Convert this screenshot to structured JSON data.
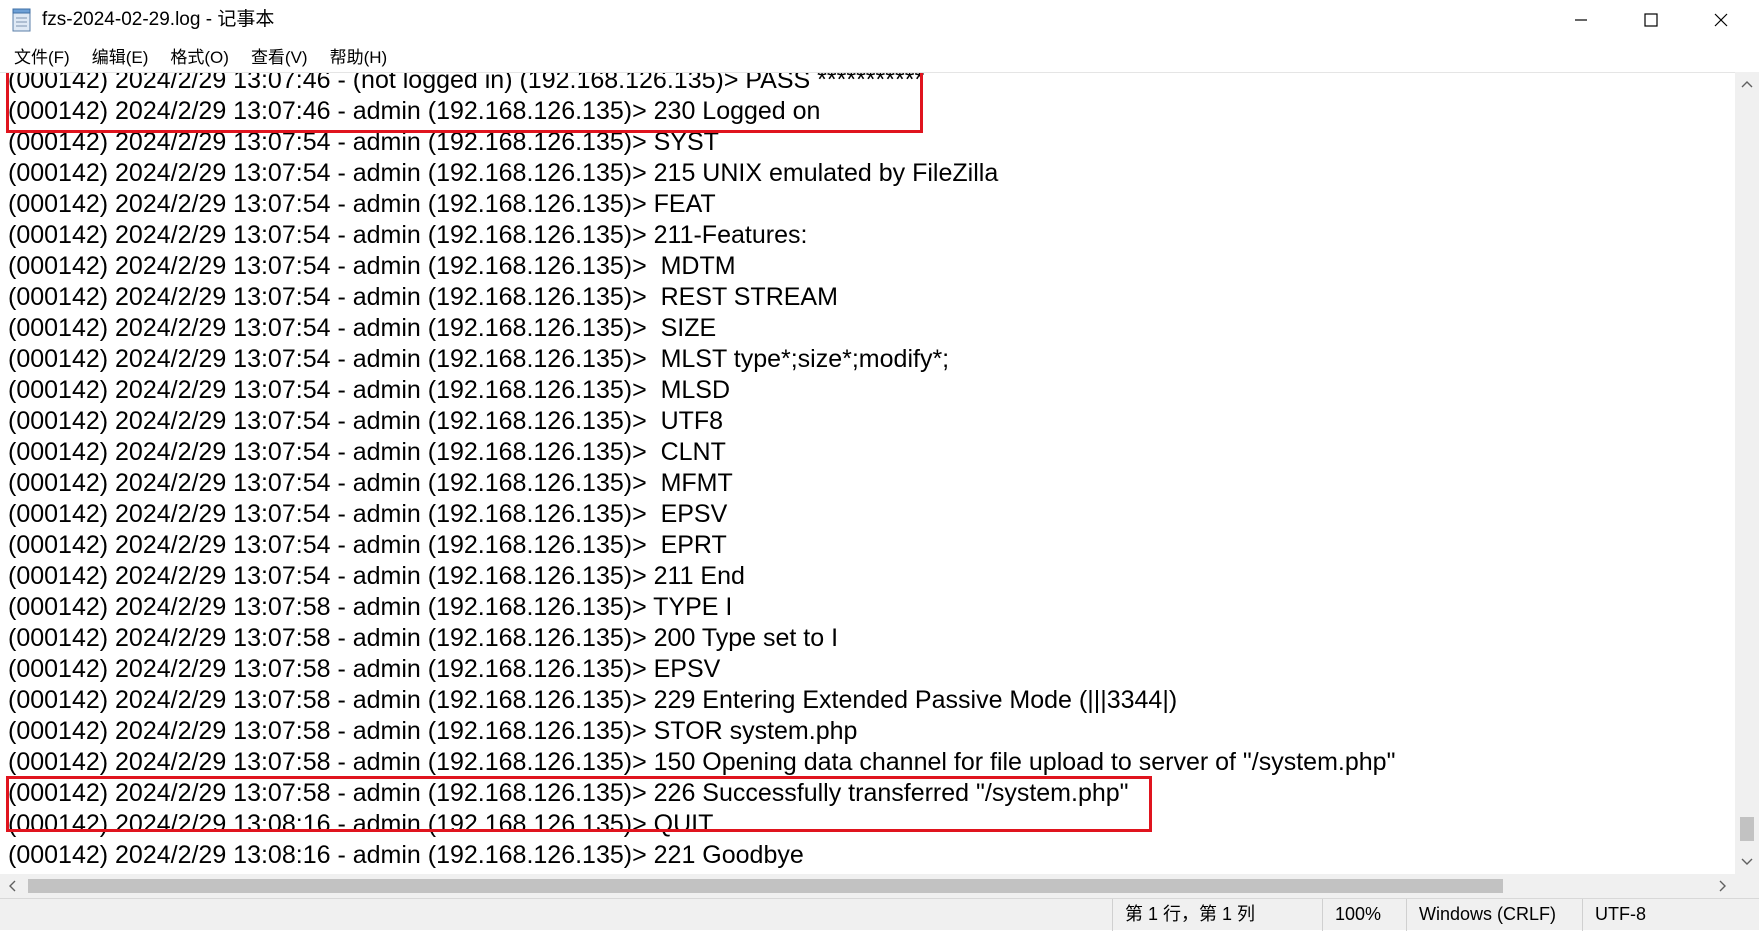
{
  "window": {
    "title": "fzs-2024-02-29.log - 记事本",
    "controls": {
      "minimize": "—",
      "maximize": "☐",
      "close": "✕"
    }
  },
  "menu": {
    "items": [
      {
        "label": "文件(F)"
      },
      {
        "label": "编辑(E)"
      },
      {
        "label": "格式(O)"
      },
      {
        "label": "查看(V)"
      },
      {
        "label": "帮助(H)"
      }
    ]
  },
  "editor": {
    "lines": [
      "(000142) 2024/2/29 13:07:46 - (not logged in) (192.168.126.135)> PASS ***********",
      "(000142) 2024/2/29 13:07:46 - admin (192.168.126.135)> 230 Logged on",
      "(000142) 2024/2/29 13:07:54 - admin (192.168.126.135)> SYST",
      "(000142) 2024/2/29 13:07:54 - admin (192.168.126.135)> 215 UNIX emulated by FileZilla",
      "(000142) 2024/2/29 13:07:54 - admin (192.168.126.135)> FEAT",
      "(000142) 2024/2/29 13:07:54 - admin (192.168.126.135)> 211-Features:",
      "(000142) 2024/2/29 13:07:54 - admin (192.168.126.135)>  MDTM",
      "(000142) 2024/2/29 13:07:54 - admin (192.168.126.135)>  REST STREAM",
      "(000142) 2024/2/29 13:07:54 - admin (192.168.126.135)>  SIZE",
      "(000142) 2024/2/29 13:07:54 - admin (192.168.126.135)>  MLST type*;size*;modify*;",
      "(000142) 2024/2/29 13:07:54 - admin (192.168.126.135)>  MLSD",
      "(000142) 2024/2/29 13:07:54 - admin (192.168.126.135)>  UTF8",
      "(000142) 2024/2/29 13:07:54 - admin (192.168.126.135)>  CLNT",
      "(000142) 2024/2/29 13:07:54 - admin (192.168.126.135)>  MFMT",
      "(000142) 2024/2/29 13:07:54 - admin (192.168.126.135)>  EPSV",
      "(000142) 2024/2/29 13:07:54 - admin (192.168.126.135)>  EPRT",
      "(000142) 2024/2/29 13:07:54 - admin (192.168.126.135)> 211 End",
      "(000142) 2024/2/29 13:07:58 - admin (192.168.126.135)> TYPE I",
      "(000142) 2024/2/29 13:07:58 - admin (192.168.126.135)> 200 Type set to I",
      "(000142) 2024/2/29 13:07:58 - admin (192.168.126.135)> EPSV",
      "(000142) 2024/2/29 13:07:58 - admin (192.168.126.135)> 229 Entering Extended Passive Mode (|||3344|)",
      "(000142) 2024/2/29 13:07:58 - admin (192.168.126.135)> STOR system.php",
      "(000142) 2024/2/29 13:07:58 - admin (192.168.126.135)> 150 Opening data channel for file upload to server of \"/system.php\"",
      "(000142) 2024/2/29 13:07:58 - admin (192.168.126.135)> 226 Successfully transferred \"/system.php\"",
      "(000142) 2024/2/29 13:08:16 - admin (192.168.126.135)> QUIT",
      "(000142) 2024/2/29 13:08:16 - admin (192.168.126.135)> 221 Goodbye"
    ],
    "annotation_color": "#e0141e"
  },
  "icons": {
    "app": "notepad-icon",
    "scroll_up": "chevron-up-icon",
    "scroll_down": "chevron-down-icon",
    "scroll_left": "chevron-left-icon",
    "scroll_right": "chevron-right-icon"
  },
  "status": {
    "position": "第 1 行，第 1 列",
    "zoom": "100%",
    "line_ending": "Windows (CRLF)",
    "encoding": "UTF-8"
  }
}
